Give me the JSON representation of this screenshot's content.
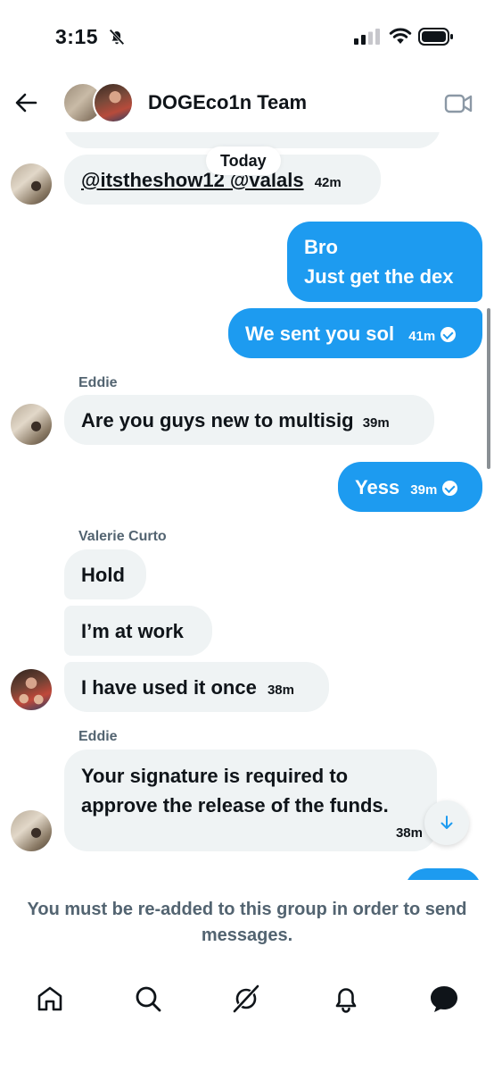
{
  "status_bar": {
    "time": "3:15"
  },
  "header": {
    "title": "DOGEco1n Team"
  },
  "date_divider": "Today",
  "messages": [
    {
      "text": "@itstheshow12 @valals",
      "time": "42m"
    },
    {
      "text_line1": "Bro",
      "text_line2": "Just get the dex"
    },
    {
      "text": "We sent you sol",
      "time": "41m"
    },
    {
      "sender": "Eddie",
      "text": "Are you guys new to multisig",
      "time": "39m"
    },
    {
      "text": "Yess",
      "time": "39m"
    },
    {
      "sender": "Valerie Curto",
      "text": "Hold"
    },
    {
      "text": "I’m at work"
    },
    {
      "text": "I have used it once",
      "time": "38m"
    },
    {
      "sender": "Eddie",
      "text_line1": "Your signature is required to",
      "text_line2": "approve the release of the funds.",
      "time": "38m"
    }
  ],
  "notice": "You must be re-added to this group in order to send messages.",
  "nav": [
    "home-icon",
    "search-icon",
    "grok-icon",
    "notifications-icon",
    "messages-icon"
  ],
  "colors": {
    "accent": "#1d9bf0",
    "incoming_bubble": "#eff3f4",
    "muted_text": "#536471"
  }
}
